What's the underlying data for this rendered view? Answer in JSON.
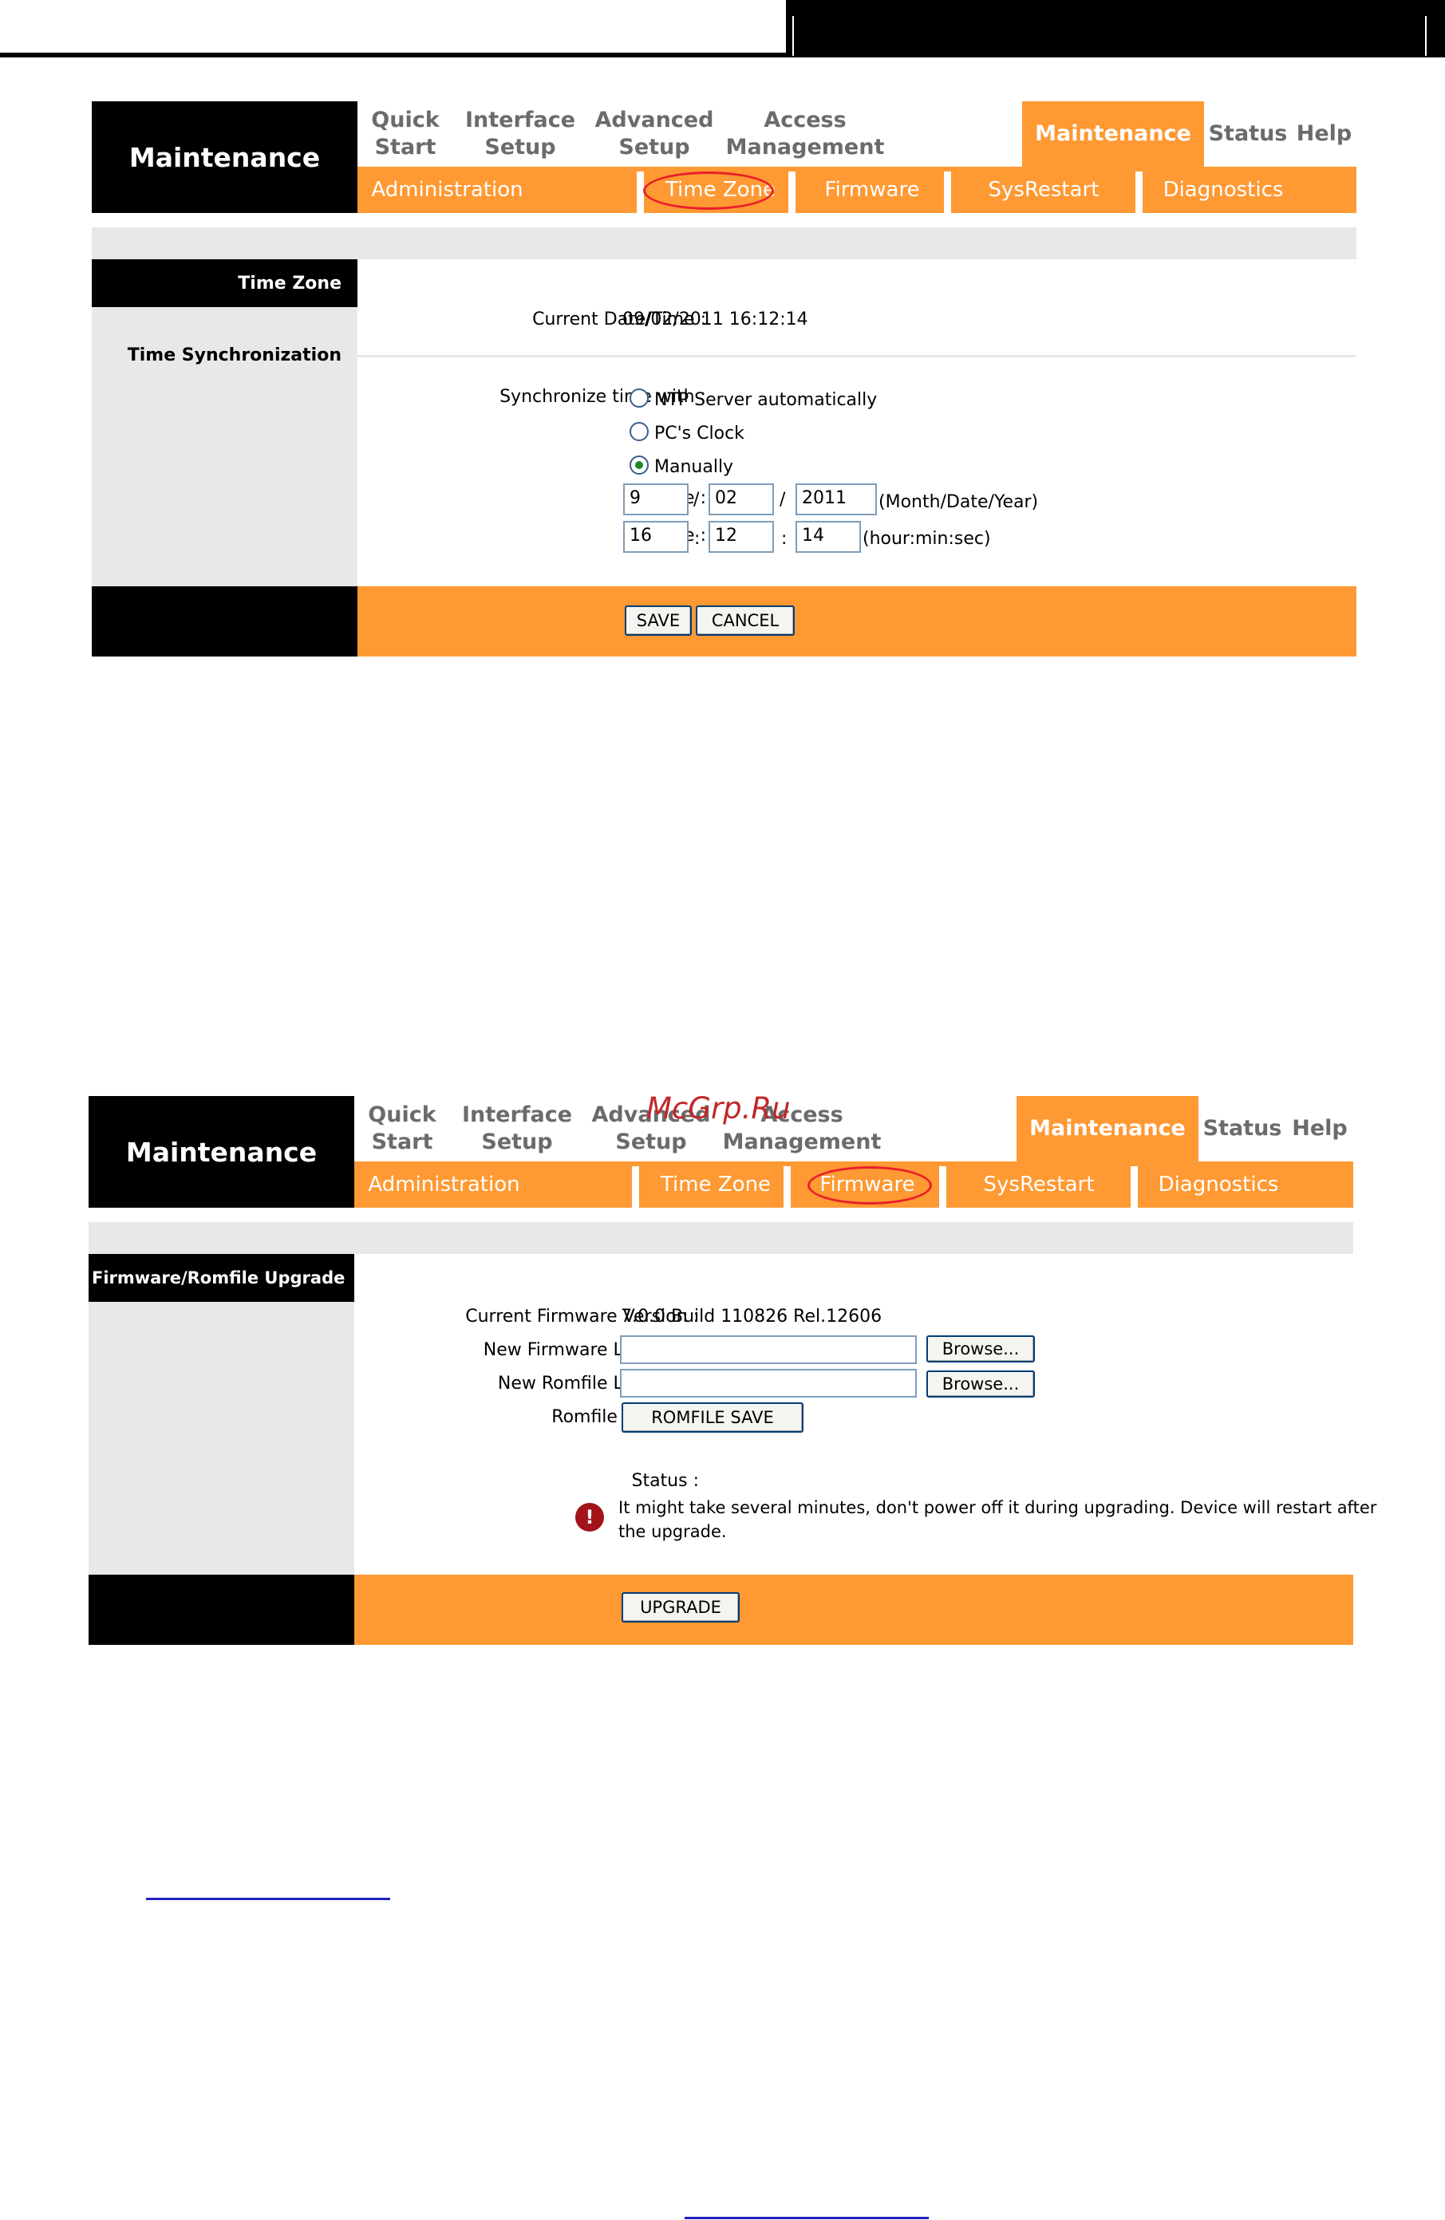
{
  "panel1": {
    "brand": "Maintenance",
    "nav": [
      {
        "l1": "Quick",
        "l2": "Start"
      },
      {
        "l1": "Interface",
        "l2": "Setup"
      },
      {
        "l1": "Advanced",
        "l2": "Setup"
      },
      {
        "l1": "Access",
        "l2": "Management"
      },
      {
        "l1": "Maintenance",
        "l2": ""
      },
      {
        "l1": "Status",
        "l2": ""
      },
      {
        "l1": "Help",
        "l2": ""
      }
    ],
    "sub": [
      "Administration",
      "Time Zone",
      "Firmware",
      "SysRestart",
      "Diagnostics"
    ],
    "section_head": "Time Zone",
    "side_label": "Time Synchronization",
    "current_label": "Current Date/Time :",
    "current_value": "09/02/2011 16:12:14",
    "sync_label": "Synchronize time with :",
    "options": [
      "NTP Server automatically",
      "PC's Clock",
      "Manually"
    ],
    "selected_option": "Manually",
    "date_label": "Date :",
    "date": {
      "month": "9",
      "day": "02",
      "year": "2011"
    },
    "date_sep": "/",
    "date_hint": "(Month/Date/Year)",
    "time_label": "Time :",
    "time": {
      "hour": "16",
      "min": "12",
      "sec": "14"
    },
    "time_sep": ":",
    "time_hint": "(hour:min:sec)",
    "save": "SAVE",
    "cancel": "CANCEL"
  },
  "panel2": {
    "brand": "Maintenance",
    "nav": [
      {
        "l1": "Quick",
        "l2": "Start"
      },
      {
        "l1": "Interface",
        "l2": "Setup"
      },
      {
        "l1": "Advanced",
        "l2": "Setup"
      },
      {
        "l1": "Access",
        "l2": "Management"
      },
      {
        "l1": "Maintenance",
        "l2": ""
      },
      {
        "l1": "Status",
        "l2": ""
      },
      {
        "l1": "Help",
        "l2": ""
      }
    ],
    "sub": [
      "Administration",
      "Time Zone",
      "Firmware",
      "SysRestart",
      "Diagnostics"
    ],
    "section_head": "Firmware/Romfile Upgrade",
    "fw_version_label": "Current Firmware Version :",
    "fw_version": "7.0.0 Build 110826 Rel.12606",
    "new_fw_label": "New Firmware Location :",
    "new_romfile_label": "New Romfile Location :",
    "browse": "Browse...",
    "romfile_backup_label": "Romfile Backup :",
    "romfile_save": "ROMFILE SAVE",
    "status_label": "Status :",
    "warning_line1": "It might take several minutes, don't power off it during upgrading. Device will restart after",
    "warning_line2": "the upgrade.",
    "upgrade": "UPGRADE"
  },
  "watermark": "McGrp.Ru",
  "colors": {
    "accent": "#ff9933",
    "dark": "#000000",
    "highlight": "#e8202a",
    "gray": "#e8e8e8"
  }
}
